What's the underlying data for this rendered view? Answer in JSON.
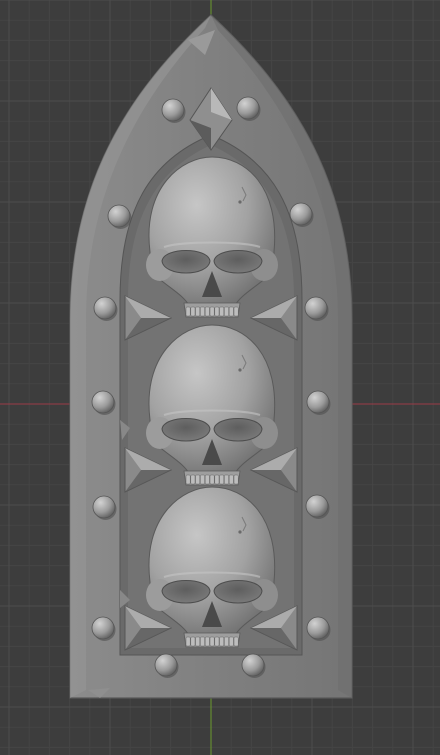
{
  "viewport": {
    "background_color": "#3d3d3d",
    "grid_minor_color": "#454545",
    "grid_major_color": "#4d4d4d",
    "x_axis_color": "#9b3b47",
    "y_axis_color": "#6b9a2d"
  },
  "model": {
    "panel_color": "#7f7f7f",
    "rim_color": "#8a8a8a",
    "recess_color": "#6b6b6b",
    "bone_color": "#a4a4a4",
    "skull_count": 3,
    "rivet_count": 14,
    "spike_count": 6
  }
}
